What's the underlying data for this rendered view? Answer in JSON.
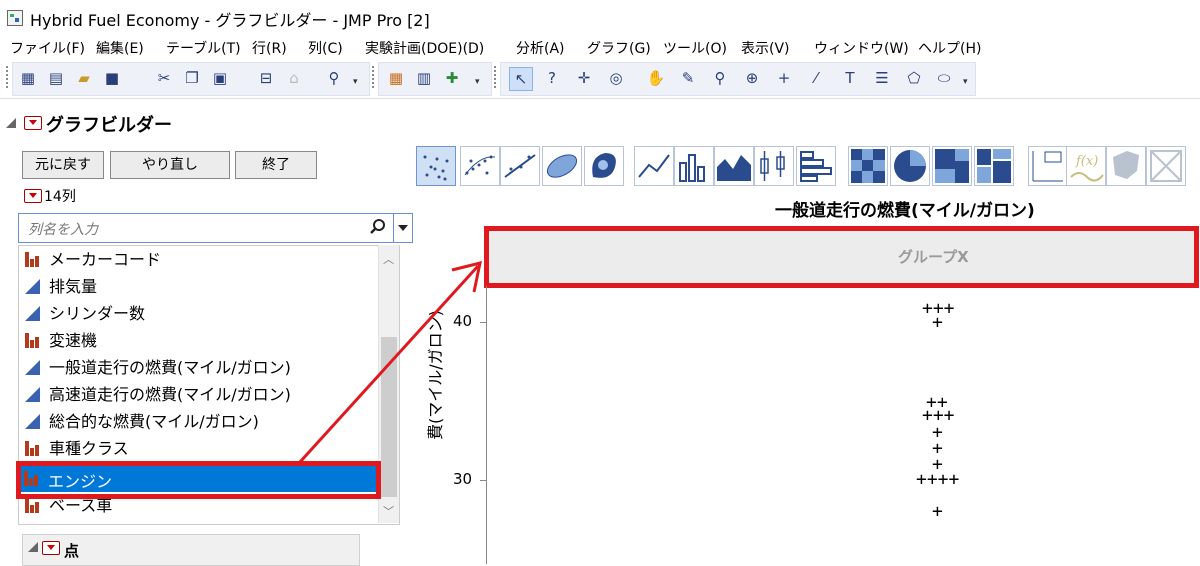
{
  "window": {
    "title": "Hybrid Fuel Economy - グラフビルダー - JMP Pro [2]"
  },
  "menu": [
    "ファイル(F)",
    "編集(E)",
    "テーブル(T)",
    "行(R)",
    "列(C)",
    "実験計画(DOE)(D)",
    "分析(A)",
    "グラフ(G)",
    "ツール(O)",
    "表示(V)",
    "ウィンドウ(W)",
    "ヘルプ(H)"
  ],
  "toolbar_icons": [
    "new-table-icon",
    "new-script-icon",
    "open-icon",
    "save-icon",
    "cut-icon",
    "copy-icon",
    "paste-icon",
    "data-table-icon",
    "lock-icon",
    "search-icon",
    "data-grid-icon",
    "distribution-icon",
    "add-icon",
    "arrow-icon",
    "help-icon",
    "crosshair-icon",
    "target-icon",
    "hand-icon",
    "brush-icon",
    "lasso-icon",
    "zoom-icon",
    "plus-icon",
    "line-icon",
    "text-icon",
    "lines-icon",
    "polygon-icon",
    "ellipse-icon"
  ],
  "graph_builder": {
    "title": "グラフビルダー",
    "buttons": {
      "undo": "元に戻す",
      "redo": "やり直し",
      "done": "終了"
    },
    "column_count": "14列",
    "search_placeholder": "列名を入力",
    "columns": [
      {
        "name": "メーカーコード",
        "type": "nominal"
      },
      {
        "name": "排気量",
        "type": "continuous"
      },
      {
        "name": "シリンダー数",
        "type": "continuous"
      },
      {
        "name": "変速機",
        "type": "nominal"
      },
      {
        "name": "一般道走行の燃費(マイル/ガロン)",
        "type": "continuous"
      },
      {
        "name": "高速道走行の燃費(マイル/ガロン)",
        "type": "continuous"
      },
      {
        "name": "総合的な燃費(マイル/ガロン)",
        "type": "continuous"
      },
      {
        "name": "車種クラス",
        "type": "nominal"
      },
      {
        "name": "エンジン",
        "type": "nominal",
        "selected": true
      },
      {
        "name": "ベース車",
        "type": "nominal"
      }
    ],
    "points_panel_label": "点",
    "graph_type_icons": [
      "points-icon",
      "jitter-icon",
      "line-of-fit-icon",
      "ellipse-icon",
      "contour-icon",
      "line-icon",
      "bar-icon",
      "area-icon",
      "box-plot-icon",
      "histogram-icon",
      "heatmap-icon",
      "pie-icon",
      "treemap-icon",
      "mosaic-icon",
      "caption-box-icon",
      "formula-icon",
      "map-shape-icon",
      "disabled-icon"
    ],
    "graph_title": "一般道走行の燃費(マイル/ガロン)",
    "group_x_label": "グループX",
    "y_axis_label": "費(マイル/ガロン)",
    "y_ticks": [
      "40",
      "30"
    ]
  },
  "colors": {
    "selection": "#0078d7",
    "highlight": "#e0191f",
    "nominal_icon": "#b23b1c",
    "continuous_icon": "#3b62b0"
  }
}
